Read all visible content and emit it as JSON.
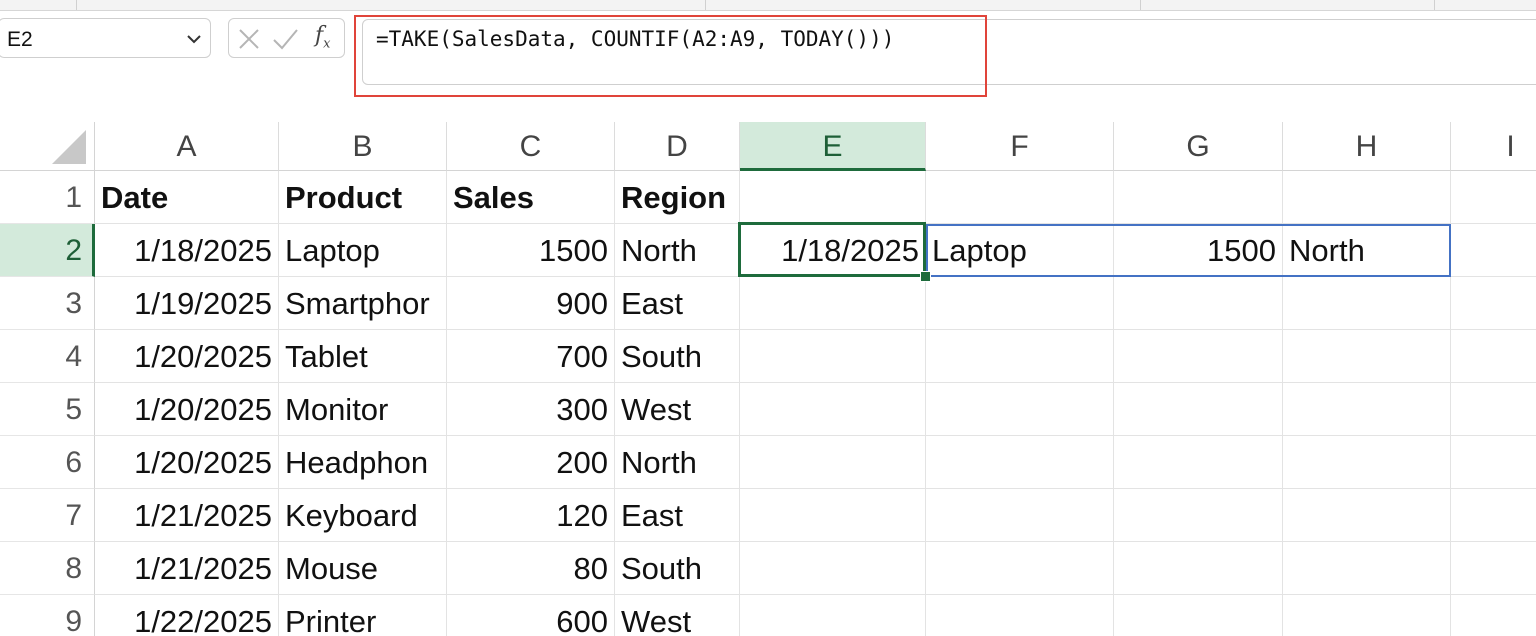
{
  "name_box": {
    "value": "E2"
  },
  "formula_bar": {
    "fx_label": "fx",
    "formula": "=TAKE(SalesData, COUNTIF(A2:A9, TODAY()))"
  },
  "colors": {
    "selection_green": "#1e6b3c",
    "header_selected_bg": "#d3eadb",
    "spill_blue": "#4472c4",
    "highlight_red": "#e0443a"
  },
  "column_headers": [
    "A",
    "B",
    "C",
    "D",
    "E",
    "F",
    "G",
    "H",
    "I"
  ],
  "row_headers": [
    "1",
    "2",
    "3",
    "4",
    "5",
    "6",
    "7",
    "8",
    "9"
  ],
  "selected_cell": {
    "column": "E",
    "row": "2"
  },
  "rows": [
    [
      "Date",
      "Product",
      "Sales",
      "Region",
      "",
      "",
      "",
      ""
    ],
    [
      "1/18/2025",
      "Laptop",
      "1500",
      "North",
      "1/18/2025",
      "Laptop",
      "1500",
      "North"
    ],
    [
      "1/19/2025",
      "Smartphor",
      "900",
      "East",
      "",
      "",
      "",
      ""
    ],
    [
      "1/20/2025",
      "Tablet",
      "700",
      "South",
      "",
      "",
      "",
      ""
    ],
    [
      "1/20/2025",
      "Monitor",
      "300",
      "West",
      "",
      "",
      "",
      ""
    ],
    [
      "1/20/2025",
      "Headphon",
      "200",
      "North",
      "",
      "",
      "",
      ""
    ],
    [
      "1/21/2025",
      "Keyboard",
      "120",
      "East",
      "",
      "",
      "",
      ""
    ],
    [
      "1/21/2025",
      "Mouse",
      "80",
      "South",
      "",
      "",
      "",
      ""
    ],
    [
      "1/22/2025",
      "Printer",
      "600",
      "West",
      "",
      "",
      "",
      ""
    ]
  ]
}
